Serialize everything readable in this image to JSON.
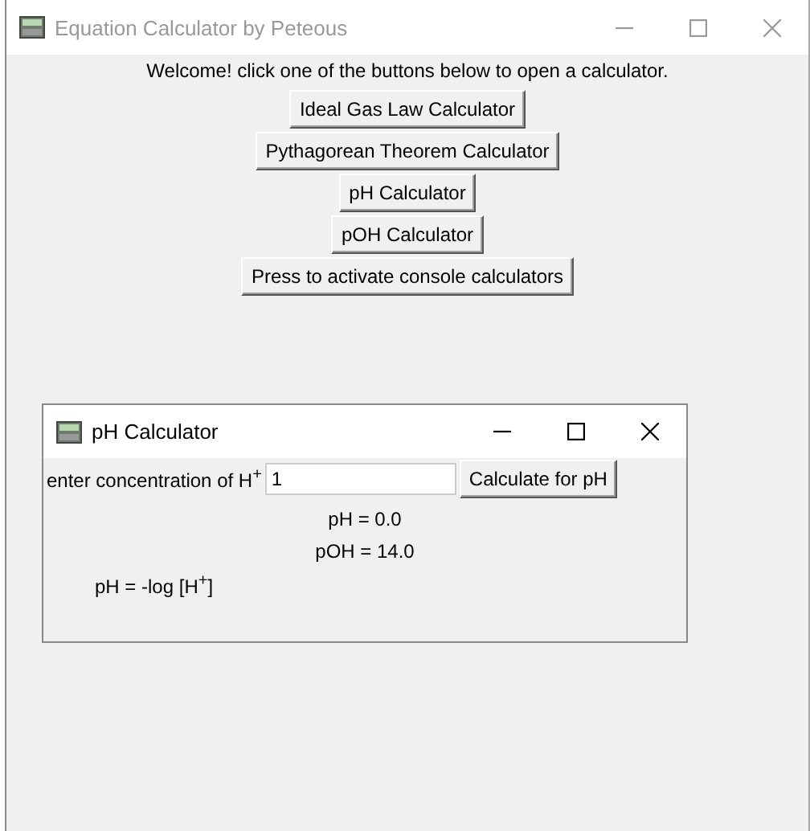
{
  "main_window": {
    "title": "Equation Calculator by Peteous",
    "active": false,
    "welcome": "Welcome! click one of the buttons below to open a calculator.",
    "buttons": [
      "Ideal Gas Law Calculator",
      "Pythagorean Theorem Calculator",
      "pH Calculator",
      "pOH Calculator",
      "Press to activate console calculators"
    ]
  },
  "ph_window": {
    "title": "pH Calculator",
    "active": true,
    "prompt": "enter concentration of H$^{+}$",
    "input": {
      "value": "1"
    },
    "calculate_button": "Calculate for pH",
    "results": [
      "pH = 0.0",
      "pOH = 14.0"
    ],
    "formula": "pH = -log [H$^{+}$]"
  }
}
